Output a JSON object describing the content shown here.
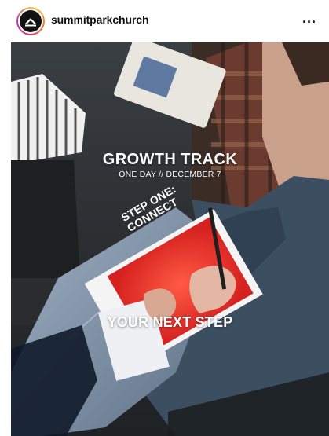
{
  "post": {
    "username": "summitparkchurch",
    "more_label": "...",
    "headline": "GROWTH TRACK",
    "subline": "ONE DAY // DECEMBER 7",
    "booklet_title": "STEP ONE: CONNECT",
    "tagline": "YOUR NEXT STEP"
  },
  "colors": {
    "avatar_ring": [
      "#f5c24a",
      "#e23a6f",
      "#b23bb3"
    ],
    "booklet_red": "#e5322f",
    "text": "#ffffff"
  },
  "icons": {
    "avatar": "church-logo-icon",
    "more": "more-options-icon"
  }
}
